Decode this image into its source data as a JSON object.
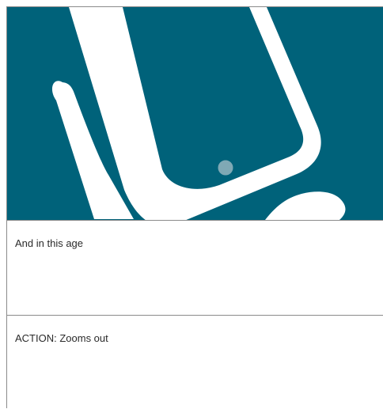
{
  "storyboard": {
    "illustration": {
      "subject": "hand-holding-smartphone-icon",
      "background_color": "#00627a",
      "foreground_color": "#ffffff",
      "button_fill_color": "#7fa9b5"
    },
    "dialogue_text": "And in this age",
    "action_text": "ACTION: Zooms out"
  }
}
